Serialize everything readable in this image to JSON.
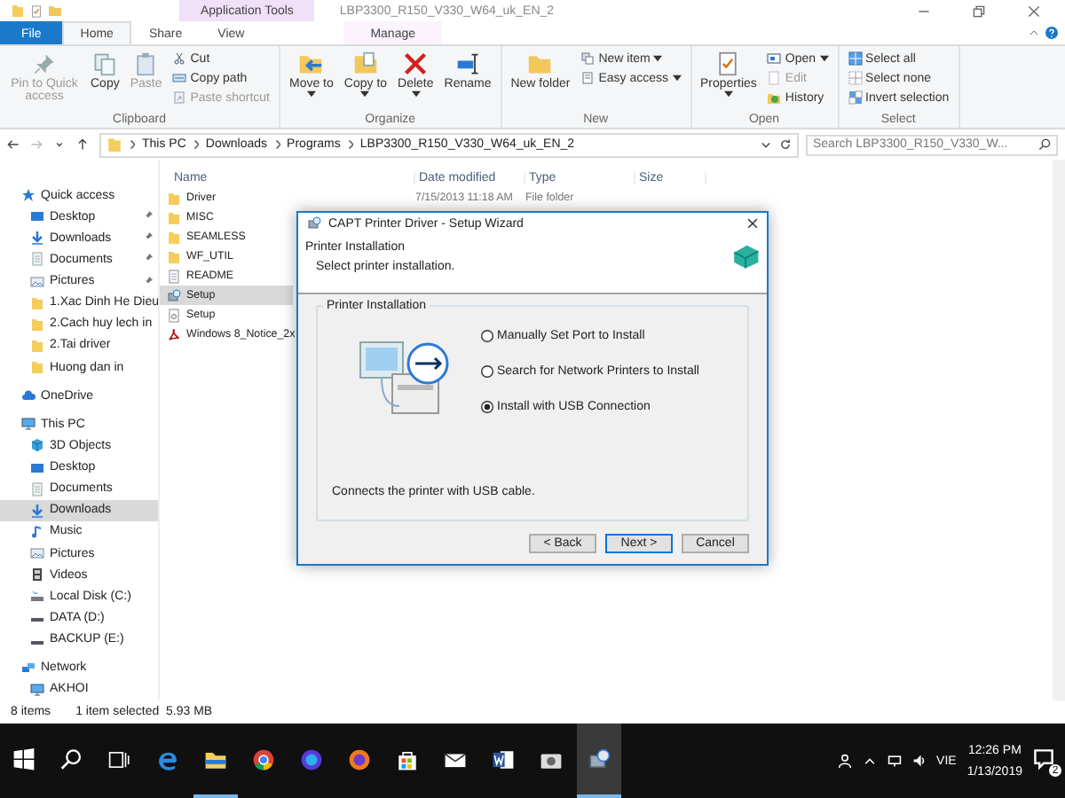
{
  "window": {
    "title": "LBP3300_R150_V330_W64_uk_EN_2",
    "context_tab": "Application Tools"
  },
  "ribbon_tabs": [
    {
      "label": "File",
      "kind": "file",
      "selected": false
    },
    {
      "label": "Home",
      "kind": "tab",
      "selected": true
    },
    {
      "label": "Share",
      "kind": "tab",
      "selected": false
    },
    {
      "label": "View",
      "kind": "tab",
      "selected": false
    },
    {
      "label": "Manage",
      "kind": "context",
      "selected": false
    }
  ],
  "ribbon_groups": [
    {
      "name": "Clipboard",
      "columns": [
        [
          {
            "label": "Pin to Quick access",
            "kind": "pin",
            "disabled": true,
            "menu": false
          }
        ],
        [
          {
            "label": "Copy",
            "kind": "copy",
            "disabled": false,
            "menu": false
          }
        ],
        [
          {
            "label": "Paste",
            "kind": "paste",
            "disabled": true,
            "menu": false
          }
        ],
        [
          {
            "label": "Cut",
            "kind": "cut",
            "disabled": false,
            "menu": false
          },
          {
            "label": "Copy path",
            "kind": "copypath",
            "disabled": false,
            "menu": false
          },
          {
            "label": "Paste shortcut",
            "kind": "pasteshortcut",
            "disabled": true,
            "menu": false
          }
        ]
      ]
    },
    {
      "name": "Organize",
      "columns": [
        [
          {
            "label": "Move to",
            "kind": "moveto",
            "disabled": false,
            "menu": true
          }
        ],
        [
          {
            "label": "Copy to",
            "kind": "copyto",
            "disabled": false,
            "menu": true
          }
        ],
        [
          {
            "label": "Delete",
            "kind": "delete",
            "disabled": false,
            "menu": true
          }
        ],
        [
          {
            "label": "Rename",
            "kind": "rename",
            "disabled": false,
            "menu": false
          }
        ]
      ]
    },
    {
      "name": "New",
      "columns": [
        [
          {
            "label": "New folder",
            "kind": "newfolder",
            "disabled": false,
            "menu": false
          }
        ],
        [
          {
            "label": "New item",
            "kind": "newitem",
            "disabled": false,
            "menu": true
          },
          {
            "label": "Easy access",
            "kind": "easyaccess",
            "disabled": false,
            "menu": true
          }
        ]
      ]
    },
    {
      "name": "Open",
      "columns": [
        [
          {
            "label": "Properties",
            "kind": "properties",
            "disabled": false,
            "menu": true
          }
        ],
        [
          {
            "label": "Open",
            "kind": "open",
            "disabled": false,
            "menu": true
          },
          {
            "label": "Edit",
            "kind": "edit",
            "disabled": true,
            "menu": false
          },
          {
            "label": "History",
            "kind": "history",
            "disabled": false,
            "menu": false
          }
        ]
      ]
    },
    {
      "name": "Select",
      "columns": [
        [
          {
            "label": "Select all",
            "kind": "selectall",
            "disabled": false,
            "menu": false
          },
          {
            "label": "Select none",
            "kind": "selectnone",
            "disabled": false,
            "menu": false
          },
          {
            "label": "Invert selection",
            "kind": "invert",
            "disabled": false,
            "menu": false
          }
        ]
      ]
    }
  ],
  "address_bar": {
    "path": [
      "This PC",
      "Downloads",
      "Programs",
      "LBP3300_R150_V330_W64_uk_EN_2"
    ]
  },
  "search": {
    "placeholder": "Search LBP3300_R150_V330_W..."
  },
  "navigation_pane": [
    {
      "label": "Quick access",
      "kind": "star",
      "selected": false,
      "children": [
        {
          "label": "Desktop",
          "kind": "desktop",
          "selected": false,
          "pinned": true
        },
        {
          "label": "Downloads",
          "kind": "download",
          "selected": false,
          "pinned": true
        },
        {
          "label": "Documents",
          "kind": "document",
          "selected": false,
          "pinned": true
        },
        {
          "label": "Pictures",
          "kind": "pictures",
          "selected": false,
          "pinned": true
        },
        {
          "label": "1.Xac Dinh He Dieu",
          "kind": "folder",
          "selected": false,
          "pinned": false
        },
        {
          "label": "2.Cach huy lech in",
          "kind": "folder",
          "selected": false,
          "pinned": false
        },
        {
          "label": "2.Tai driver",
          "kind": "folder",
          "selected": false,
          "pinned": false
        },
        {
          "label": "Huong dan in",
          "kind": "folder",
          "selected": false,
          "pinned": false
        }
      ]
    },
    {
      "label": "OneDrive",
      "kind": "cloud",
      "selected": false
    },
    {
      "label": "This PC",
      "kind": "computer",
      "selected": false,
      "children": [
        {
          "label": "3D Objects",
          "kind": "cube",
          "selected": false,
          "pinned": false
        },
        {
          "label": "Desktop",
          "kind": "desktop",
          "selected": false,
          "pinned": false
        },
        {
          "label": "Documents",
          "kind": "document",
          "selected": false,
          "pinned": false
        },
        {
          "label": "Downloads",
          "kind": "download",
          "selected": true,
          "pinned": false
        },
        {
          "label": "Music",
          "kind": "music",
          "selected": false,
          "pinned": false
        },
        {
          "label": "Pictures",
          "kind": "pictures",
          "selected": false,
          "pinned": false
        },
        {
          "label": "Videos",
          "kind": "video",
          "selected": false,
          "pinned": false
        },
        {
          "label": "Local Disk (C:)",
          "kind": "systemdisk",
          "selected": false,
          "pinned": false
        },
        {
          "label": "DATA (D:)",
          "kind": "disk",
          "selected": false,
          "pinned": false
        },
        {
          "label": "BACKUP (E:)",
          "kind": "disk",
          "selected": false,
          "pinned": false
        }
      ]
    },
    {
      "label": "Network",
      "kind": "network",
      "selected": false,
      "children": [
        {
          "label": "AKHOI",
          "kind": "computer",
          "selected": false,
          "pinned": false
        }
      ]
    }
  ],
  "file_list": {
    "columns": [
      "Name",
      "Date modified",
      "Type",
      "Size"
    ],
    "rows": [
      {
        "name": "Driver",
        "kind": "folder",
        "date_modified": "7/15/2013 11:18 AM",
        "type": "File folder",
        "selected": false
      },
      {
        "name": "MISC",
        "kind": "folder",
        "selected": false
      },
      {
        "name": "SEAMLESS",
        "kind": "folder",
        "selected": false
      },
      {
        "name": "WF_UTIL",
        "kind": "folder",
        "selected": false
      },
      {
        "name": "README",
        "kind": "text",
        "selected": false
      },
      {
        "name": "Setup",
        "kind": "setup",
        "selected": true
      },
      {
        "name": "Setup",
        "kind": "settingsfile",
        "selected": false
      },
      {
        "name": "Windows 8_Notice_2x",
        "kind": "pdf",
        "selected": false
      }
    ]
  },
  "status_bar": {
    "item_count": "8 items",
    "selection": "1 item selected  5.93 MB"
  },
  "dialog": {
    "title": "CAPT Printer Driver - Setup Wizard",
    "heading": "Printer Installation",
    "subheading": "Select printer installation.",
    "group_label": "Printer Installation",
    "options": [
      {
        "label": "Manually Set Port to Install",
        "selected": false
      },
      {
        "label": "Search for Network Printers to Install",
        "selected": false
      },
      {
        "label": "Install with USB Connection",
        "selected": true
      }
    ],
    "description": "Connects the printer with USB cable.",
    "buttons": [
      {
        "label": "< Back",
        "default": false
      },
      {
        "label": "Next >",
        "default": true
      },
      {
        "label": "Cancel",
        "default": false
      }
    ]
  },
  "taskbar": {
    "apps": [
      {
        "kind": "start",
        "running": false,
        "active": false
      },
      {
        "kind": "search",
        "running": false,
        "active": false
      },
      {
        "kind": "taskview",
        "running": false,
        "active": false
      },
      {
        "kind": "edge",
        "running": false,
        "active": false
      },
      {
        "kind": "explorer",
        "running": true,
        "active": false
      },
      {
        "kind": "chrome",
        "running": false,
        "active": false
      },
      {
        "kind": "browser",
        "running": false,
        "active": false
      },
      {
        "kind": "firefox",
        "running": false,
        "active": false
      },
      {
        "kind": "store",
        "running": false,
        "active": false
      },
      {
        "kind": "mail",
        "running": false,
        "active": false
      },
      {
        "kind": "word",
        "running": false,
        "active": false
      },
      {
        "kind": "camera",
        "running": false,
        "active": false
      },
      {
        "kind": "setup",
        "running": true,
        "active": true
      }
    ],
    "language": "VIE",
    "time": "12:26 PM",
    "date": "1/13/2019",
    "notification_count": "2"
  }
}
